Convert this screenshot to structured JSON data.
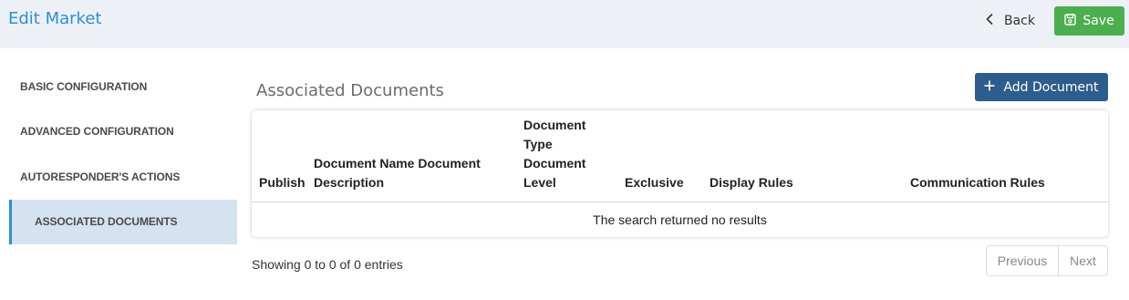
{
  "header": {
    "title": "Edit Market",
    "back_label": "Back",
    "save_label": "Save"
  },
  "sidebar": {
    "items": [
      {
        "label": "BASIC CONFIGURATION",
        "active": false
      },
      {
        "label": "ADVANCED CONFIGURATION",
        "active": false
      },
      {
        "label": "AUTORESPONDER'S ACTIONS",
        "active": false
      },
      {
        "label": "ASSOCIATED DOCUMENTS",
        "active": true
      }
    ]
  },
  "main": {
    "section_title": "Associated Documents",
    "add_button_label": "Add Document",
    "table": {
      "columns": [
        "Publish",
        "Document Name Document Description",
        "Document Type Document Level",
        "Exclusive",
        "Display Rules",
        "Communication Rules"
      ],
      "rows": [],
      "empty_message": "The search returned no results"
    },
    "info_text": "Showing 0 to 0 of 0 entries",
    "pagination": {
      "previous_label": "Previous",
      "next_label": "Next"
    }
  },
  "colors": {
    "accent": "#2b8fd8",
    "save_button": "#4cae4f",
    "add_button": "#2c5d8c",
    "header_bg": "#edf1f5",
    "active_nav_bg": "#d5e3f1"
  },
  "icons": {
    "back": "chevron-left-icon",
    "save": "floppy-disk-icon",
    "add": "plus-icon"
  }
}
